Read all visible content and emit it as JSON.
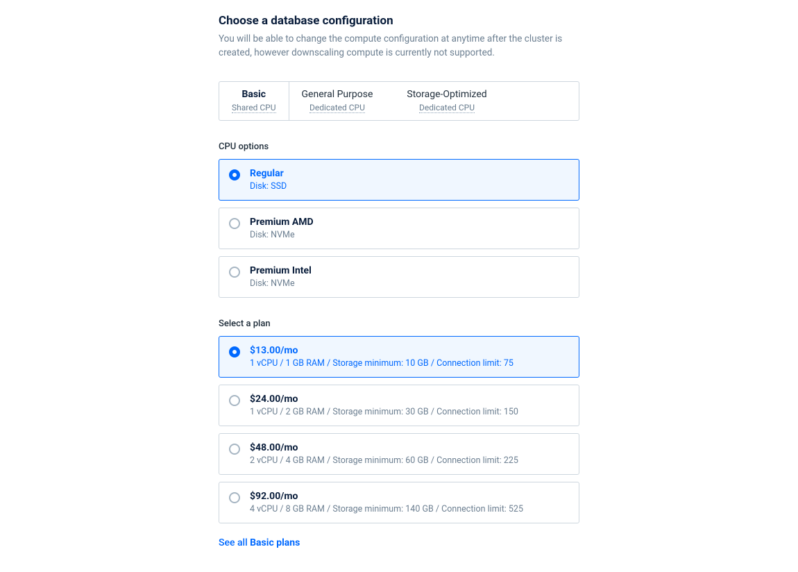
{
  "header": {
    "title": "Choose a database configuration",
    "subtitle": "You will be able to change the compute configuration at anytime after the cluster is created, however downscaling compute is currently not supported."
  },
  "tabs": [
    {
      "title": "Basic",
      "subtitle": "Shared CPU",
      "active": true
    },
    {
      "title": "General Purpose",
      "subtitle": "Dedicated CPU",
      "active": false
    },
    {
      "title": "Storage-Optimized",
      "subtitle": "Dedicated CPU",
      "active": false
    }
  ],
  "cpu": {
    "section_label": "CPU options",
    "options": [
      {
        "title": "Regular",
        "desc": "Disk: SSD",
        "selected": true
      },
      {
        "title": "Premium AMD",
        "desc": "Disk: NVMe",
        "selected": false
      },
      {
        "title": "Premium Intel",
        "desc": "Disk: NVMe",
        "selected": false
      }
    ]
  },
  "plan": {
    "section_label": "Select a plan",
    "options": [
      {
        "title": "$13.00/mo",
        "desc": "1 vCPU / 1 GB RAM / Storage minimum: 10 GB / Connection limit: 75",
        "selected": true
      },
      {
        "title": "$24.00/mo",
        "desc": "1 vCPU / 2 GB RAM / Storage minimum: 30 GB / Connection limit: 150",
        "selected": false
      },
      {
        "title": "$48.00/mo",
        "desc": "2 vCPU / 4 GB RAM / Storage minimum: 60 GB / Connection limit: 225",
        "selected": false
      },
      {
        "title": "$92.00/mo",
        "desc": "4 vCPU / 8 GB RAM / Storage minimum: 140 GB / Connection limit: 525",
        "selected": false
      }
    ]
  },
  "footer": {
    "link_prefix": "See all ",
    "link_bold": "Basic plans"
  }
}
